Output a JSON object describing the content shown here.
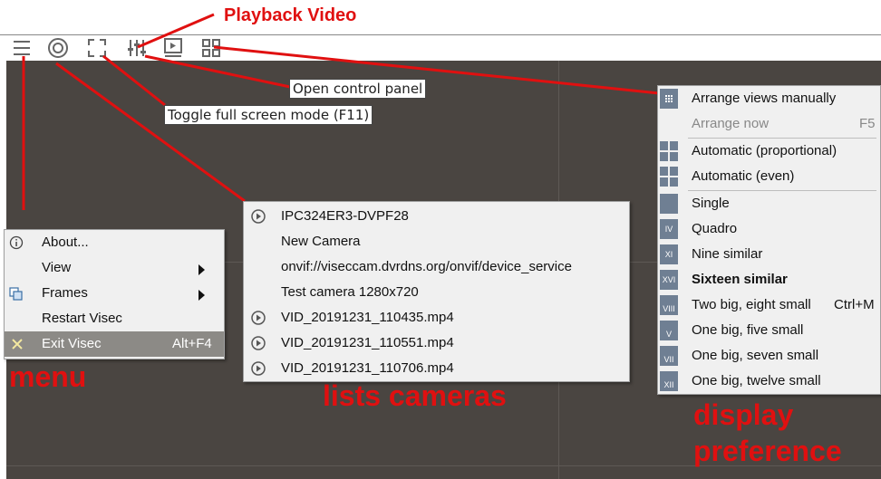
{
  "annotations": {
    "playback": "Playback Video",
    "menu": "menu",
    "cameras": "lists cameras",
    "display_line1": "display",
    "display_line2": "preference"
  },
  "tooltips": {
    "control_panel": "Open control panel",
    "fullscreen": "Toggle full screen mode (F11)"
  },
  "toolbar": {
    "icons": [
      "hamburger-icon",
      "camera-target-icon",
      "fullscreen-icon",
      "sliders-icon",
      "playback-icon",
      "grid-layout-icon"
    ]
  },
  "main_menu": {
    "items": [
      {
        "label": "About...",
        "icon": "info-icon"
      },
      {
        "label": "View",
        "submenu": true
      },
      {
        "label": "Frames",
        "icon": "frames-icon",
        "submenu": true
      },
      {
        "label": "Restart Visec"
      },
      {
        "label": "Exit Visec",
        "icon": "close-icon",
        "shortcut": "Alt+F4",
        "highlighted": true
      }
    ]
  },
  "camera_menu": {
    "items": [
      {
        "label": "IPC324ER3-DVPF28",
        "icon": "play-circle-icon"
      },
      {
        "label": "New Camera"
      },
      {
        "label": "onvif://viseccam.dvrdns.org/onvif/device_service"
      },
      {
        "label": "Test camera 1280x720"
      },
      {
        "label": "VID_20191231_110435.mp4",
        "icon": "play-circle-icon"
      },
      {
        "label": "VID_20191231_110551.mp4",
        "icon": "play-circle-icon"
      },
      {
        "label": "VID_20191231_110706.mp4",
        "icon": "play-circle-icon"
      }
    ]
  },
  "layout_menu": {
    "items": [
      {
        "label": "Arrange views manually",
        "icon": "manual-arrange-icon"
      },
      {
        "label": "Arrange now",
        "shortcut": "F5",
        "disabled": true
      },
      {
        "label": "Automatic (proportional)",
        "icon": "auto-grid-icon"
      },
      {
        "label": "Automatic (even)",
        "icon": "auto-grid-icon"
      },
      {
        "label": "Single",
        "icon": "single-view-icon"
      },
      {
        "label": "Quadro",
        "icon": "quadro-icon",
        "numeral": "IV"
      },
      {
        "label": "Nine similar",
        "icon": "nine-icon",
        "numeral": "XI"
      },
      {
        "label": "Sixteen similar",
        "icon": "sixteen-icon",
        "numeral": "XVI",
        "bold": true
      },
      {
        "label": "Two big, eight small",
        "shortcut": "Ctrl+M",
        "icon": "two-big-icon",
        "numeral": "VIII"
      },
      {
        "label": "One big, five small",
        "icon": "one-big-five-icon",
        "numeral": "V"
      },
      {
        "label": "One big, seven small",
        "icon": "one-big-seven-icon",
        "numeral": "VII"
      },
      {
        "label": "One big, twelve small",
        "icon": "one-big-twelve-icon",
        "numeral": "XII"
      }
    ]
  },
  "colors": {
    "annotation": "#e01010",
    "stage": "#4a4541",
    "menu_bg": "#f0f0f0",
    "highlight": "#8c8a86",
    "layout_icon": "#6f7f93"
  }
}
